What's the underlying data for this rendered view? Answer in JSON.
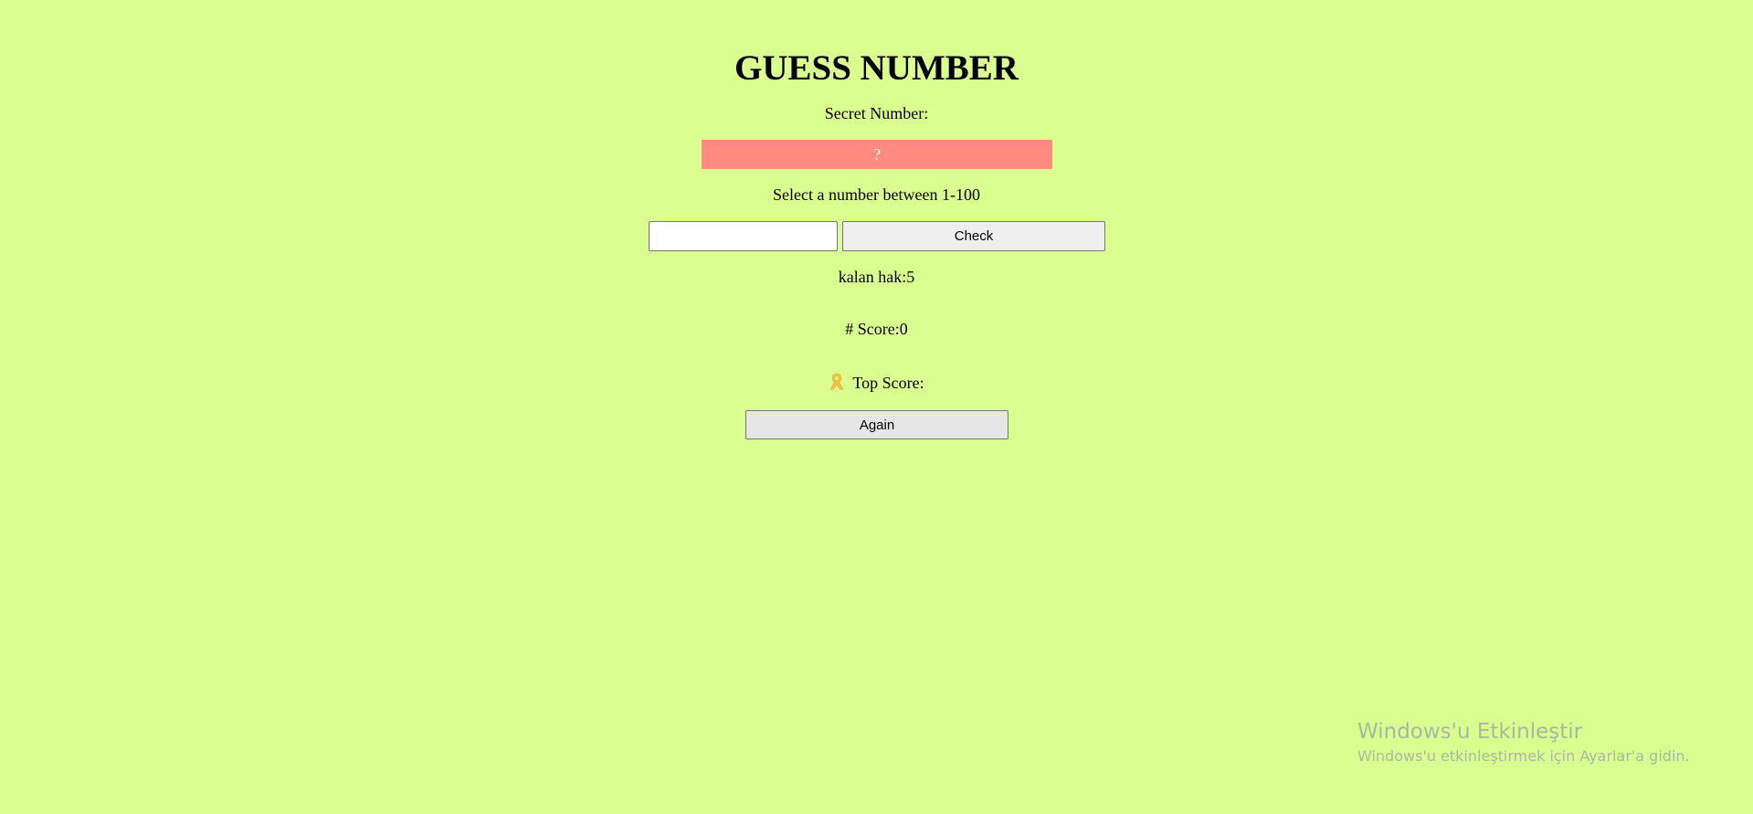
{
  "game": {
    "title": "GUESS NUMBER",
    "secret_label": "Secret Number:",
    "secret_value": "?",
    "range_label": "Select a number between 1-100",
    "guess_input": {
      "value": "",
      "placeholder": ""
    },
    "check_label": "Check",
    "rights_label": "kalan hak:5",
    "score_label": "# Score:0",
    "top_score_icon": "reminder-ribbon-icon",
    "top_score_label": "Top Score:",
    "again_label": "Again"
  },
  "watermark": {
    "title": "Windows'u Etkinleştir",
    "subtitle": "Windows'u etkinleştirmek için Ayarlar'a gidin."
  },
  "colors": {
    "background": "#daff90",
    "secret_box": "#ff8a80",
    "ribbon": "#f5c242"
  }
}
